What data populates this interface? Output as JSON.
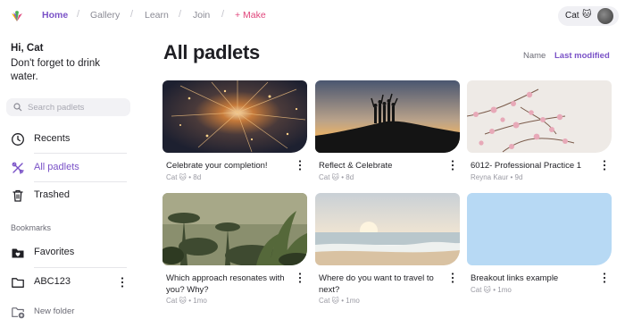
{
  "nav": {
    "items": [
      "Home",
      "Gallery",
      "Learn",
      "Join"
    ],
    "make": "+ Make"
  },
  "user": {
    "name": "Cat",
    "emoji": "🐱"
  },
  "sidebar": {
    "greeting_title": "Hi, Cat",
    "greeting_text": "Don't forget to drink water.",
    "search_placeholder": "Search padlets",
    "items": [
      {
        "label": "Recents",
        "icon": "clock-icon"
      },
      {
        "label": "All padlets",
        "icon": "padlets-icon"
      },
      {
        "label": "Trashed",
        "icon": "trash-icon"
      }
    ],
    "bookmarks_heading": "Bookmarks",
    "bookmarks": [
      {
        "label": "Favorites",
        "icon": "heart-folder-icon"
      },
      {
        "label": "ABC123",
        "icon": "folder-icon"
      }
    ],
    "new_folder": "New folder"
  },
  "main": {
    "title": "All padlets",
    "sort_name": "Name",
    "sort_last_modified": "Last modified"
  },
  "cards": [
    {
      "title": "Celebrate your completion!",
      "meta": "Cat 🐱 • 8d",
      "image": "fireworks"
    },
    {
      "title": "Reflect & Celebrate",
      "meta": "Cat 🐱 • 8d",
      "image": "sunset-silhouette"
    },
    {
      "title": "6012- Professional Practice 1",
      "meta": "Reyna Kaur • 9d",
      "image": "cherry-blossom"
    },
    {
      "title": "Which approach resonates with you? Why?",
      "meta": "Cat 🐱 • 1mo",
      "image": "jungle"
    },
    {
      "title": "Where do you want to travel to next?",
      "meta": "Cat 🐱 • 1mo",
      "image": "beach"
    },
    {
      "title": "Breakout links example",
      "meta": "Cat 🐱 • 1mo",
      "image": "light-blue"
    }
  ],
  "colors": {
    "accent": "#7a52c7",
    "make": "#e0457b"
  }
}
